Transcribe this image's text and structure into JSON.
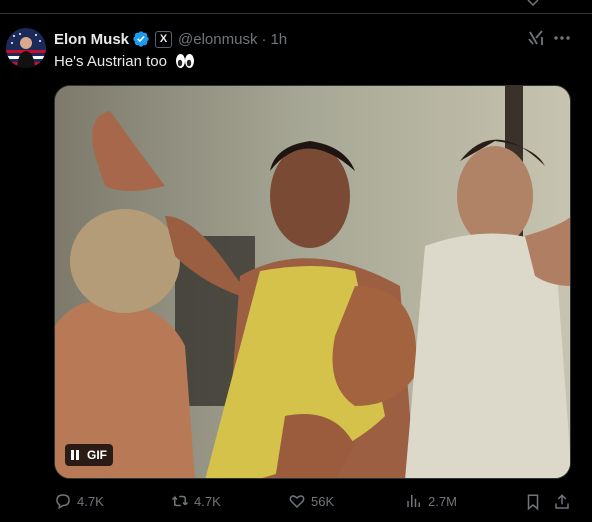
{
  "tweet": {
    "author_name": "Elon Musk",
    "affiliation_badge": "X",
    "handle": "@elonmusk",
    "separator": "·",
    "time": "1h",
    "text": "He's Austrian too"
  },
  "media": {
    "badge_label": "GIF"
  },
  "actions": {
    "replies": "4.7K",
    "reposts": "4.7K",
    "likes": "56K",
    "views": "2.7M"
  },
  "colors": {
    "verified": "#1d9bf0",
    "muted": "#71767b",
    "text": "#e7e9ea",
    "background": "#000000"
  }
}
